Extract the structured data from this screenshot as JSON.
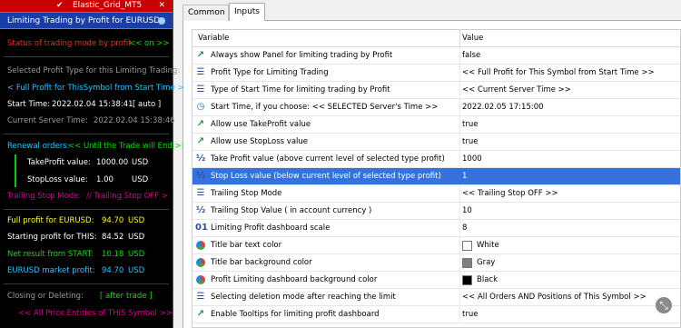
{
  "panel": {
    "titlebar": {
      "check": "✔",
      "title": "Elastic_Grid_MT5",
      "close": "✕"
    },
    "header": "Limiting Trading by Profit for  EURUSD",
    "status_label": "Status of trading mode by profit :",
    "status_value": "<< on >>",
    "selected_label": "Selected Profit Type for this Limiting Trading:",
    "selected_value": "< Full Profit for ThisSymbol from Start Time >",
    "start_label": "Start Time:",
    "start_value": "2022.02.04  15:38:41",
    "start_mode": "[ auto ]",
    "server_label": "Current Server Time:",
    "server_value": "2022.02.04  15:38:46",
    "renewal_label": "Renewal orders:",
    "renewal_value": "<< Until the Trade will End >>",
    "tp_label": "TakeProfit  value:",
    "tp_value": "1000.00",
    "tp_unit": "USD",
    "sl_label": "StopLoss  value:",
    "sl_value": "1.00",
    "sl_unit": "USD",
    "trailing_label": "Trailing Stop Mode:",
    "trailing_value": "//   Trailing Stop OFF   >",
    "full_label": "Full profit for  EURUSD:",
    "full_value": "94.70",
    "full_unit": "USD",
    "starting_label": "Starting  profit for  THIS:",
    "starting_value": "84.52",
    "starting_unit": "USD",
    "net_label": "Net result from  START:",
    "net_value": "10.18",
    "net_unit": "USD",
    "market_label": "EURUSD  market profit:",
    "market_value": "94.70",
    "market_unit": "USD",
    "closing_label": "Closing   or  Deleting:",
    "closing_value": "[ after trade ]",
    "entities_value": "<<  All Price Entities of THIS Symbol  >>",
    "colors": {
      "red": "#ff2020",
      "green": "#00e000",
      "cyan": "#27c4ff",
      "gray": "#9a9a9a",
      "yellow": "#ffff00",
      "magenta": "#d6008c",
      "white": "#ffffff"
    }
  },
  "tabs": {
    "common": "Common",
    "inputs": "Inputs"
  },
  "grid": {
    "col_variable": "Variable",
    "col_value": "Value",
    "rows": [
      {
        "icon": "arrow-icon",
        "glyph": "↗",
        "name": "Always show Panel for limiting trading by Profit",
        "value": "false"
      },
      {
        "icon": "enum-icon",
        "glyph": "☰",
        "name": "Profit Type for Limiting Trading",
        "value": "<<  Full Profit for This Symbol from Start Time  >>"
      },
      {
        "icon": "enum-icon",
        "glyph": "☰",
        "name": "Type of Start Time for limiting trading by Profit",
        "value": "<<  Current Server Time  >>"
      },
      {
        "icon": "clock-icon",
        "glyph": "◷",
        "name": "Start Time, if you choose:  <<  SELECTED Server's Time  >>",
        "value": "2022.02.05 17:15:00"
      },
      {
        "icon": "arrow-icon",
        "glyph": "↗",
        "name": "Allow use TakeProfit value",
        "value": "true"
      },
      {
        "icon": "arrow-icon",
        "glyph": "↗",
        "name": "Allow use StopLoss value",
        "value": "true"
      },
      {
        "icon": "double-icon",
        "glyph": "½",
        "name": "Take Profit value (above current level of selected type profit)",
        "value": "1000"
      },
      {
        "icon": "double-icon",
        "glyph": "½",
        "name": "Stop Loss value (below current level of selected type profit)",
        "value": "1"
      },
      {
        "icon": "enum-icon",
        "glyph": "☰",
        "name": "Trailing Stop Mode",
        "value": "<<  Trailing Stop OFF  >>"
      },
      {
        "icon": "double-icon",
        "glyph": "½",
        "name": "Trailing Stop Value  ( in account currency )",
        "value": "10"
      },
      {
        "icon": "integer-icon",
        "glyph": "01",
        "name": "Limiting Profit dashboard scale",
        "value": "8"
      },
      {
        "icon": "color-icon",
        "glyph": "❀",
        "name": "Title bar text color",
        "value": "White",
        "swatch": "#ffffff"
      },
      {
        "icon": "color-icon",
        "glyph": "❀",
        "name": "Title bar background color",
        "value": "Gray",
        "swatch": "#808080"
      },
      {
        "icon": "color-icon",
        "glyph": "❀",
        "name": "Profit Limiting dashboard background color",
        "value": "Black",
        "swatch": "#000000"
      },
      {
        "icon": "enum-icon",
        "glyph": "☰",
        "name": "Selecting deletion mode after reaching the limit",
        "value": "<<  All Orders AND Positions of This Symbol  >>"
      },
      {
        "icon": "arrow-icon",
        "glyph": "↗",
        "name": "Enable Tooltips for limiting profit dashboard",
        "value": "true"
      }
    ],
    "selected_index": 7
  },
  "resize_grip": "⤡"
}
